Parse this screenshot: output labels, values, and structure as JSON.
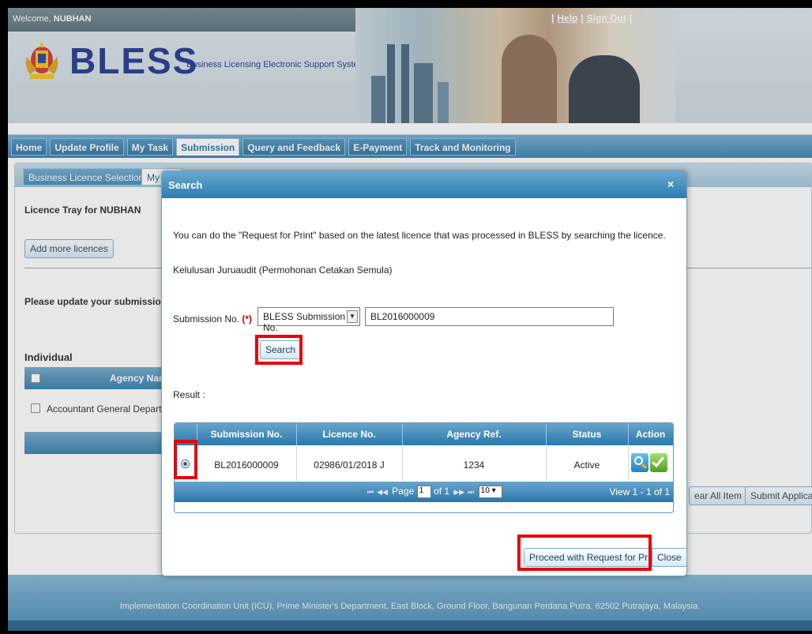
{
  "header": {
    "welcome_prefix": "Welcome, ",
    "user": "NUBHAN",
    "logo_text": "BLESS",
    "logo_subtitle": "Business Licensing Electronic Support System",
    "help_link": "Help",
    "signout_link": "Sign Out"
  },
  "nav": {
    "tabs": [
      "Home",
      "Update Profile",
      "My Task",
      "Submission",
      "Query and Feedback",
      "E-Payment",
      "Track and Monitoring"
    ],
    "active": "Submission"
  },
  "content": {
    "subtabs": [
      "Business Licence Selection",
      "My Tra"
    ],
    "tray_title": "Licence Tray for NUBHAN",
    "add_more_label": "Add more licences",
    "please_update": "Please update your submission.",
    "individual_label": "Individual",
    "agency_name_header": "Agency Name",
    "agency_row": "Accountant General Departmer",
    "clear_all_label": "ear All Item",
    "submit_label": "Submit Application"
  },
  "modal": {
    "title": "Search",
    "close_glyph": "×",
    "description": "You can do the \"Request for Print\" based on the latest licence that was processed in BLESS by searching the licence.",
    "licence_name": "Kelulusan Juruaudit (Permohonan Cetakan Semula)",
    "submission_label": "Submission No.",
    "required_mark": "(*)",
    "search_type_selected": "BLESS Submission No.",
    "search_value": "BL2016000009",
    "search_button": "Search",
    "result_label": "Result :",
    "grid": {
      "columns": [
        "Submission No.",
        "Licence No.",
        "Agency Ref.",
        "Status",
        "Action"
      ],
      "rows": [
        {
          "submission_no": "BL2016000009",
          "licence_no": "02986/01/2018 J",
          "agency_ref": "1234",
          "status": "Active"
        }
      ],
      "pager": {
        "page_label": "Page",
        "page": "1",
        "of_label": "of 1",
        "page_size": "10",
        "view_text": "View 1 - 1 of 1"
      }
    },
    "proceed_button": "Proceed with Request for Print",
    "close_button": "Close"
  },
  "footer": {
    "text": "Implementation Coordination Unit (ICU), Prime Minister's Department, East Block, Ground Floor, Bangunan Perdana Putra, 62502 Putrajaya, Malaysia."
  },
  "colors": {
    "brand_blue": "#2b7db0",
    "highlight_red": "#e8000b",
    "logo_blue": "#1a2f8c"
  }
}
